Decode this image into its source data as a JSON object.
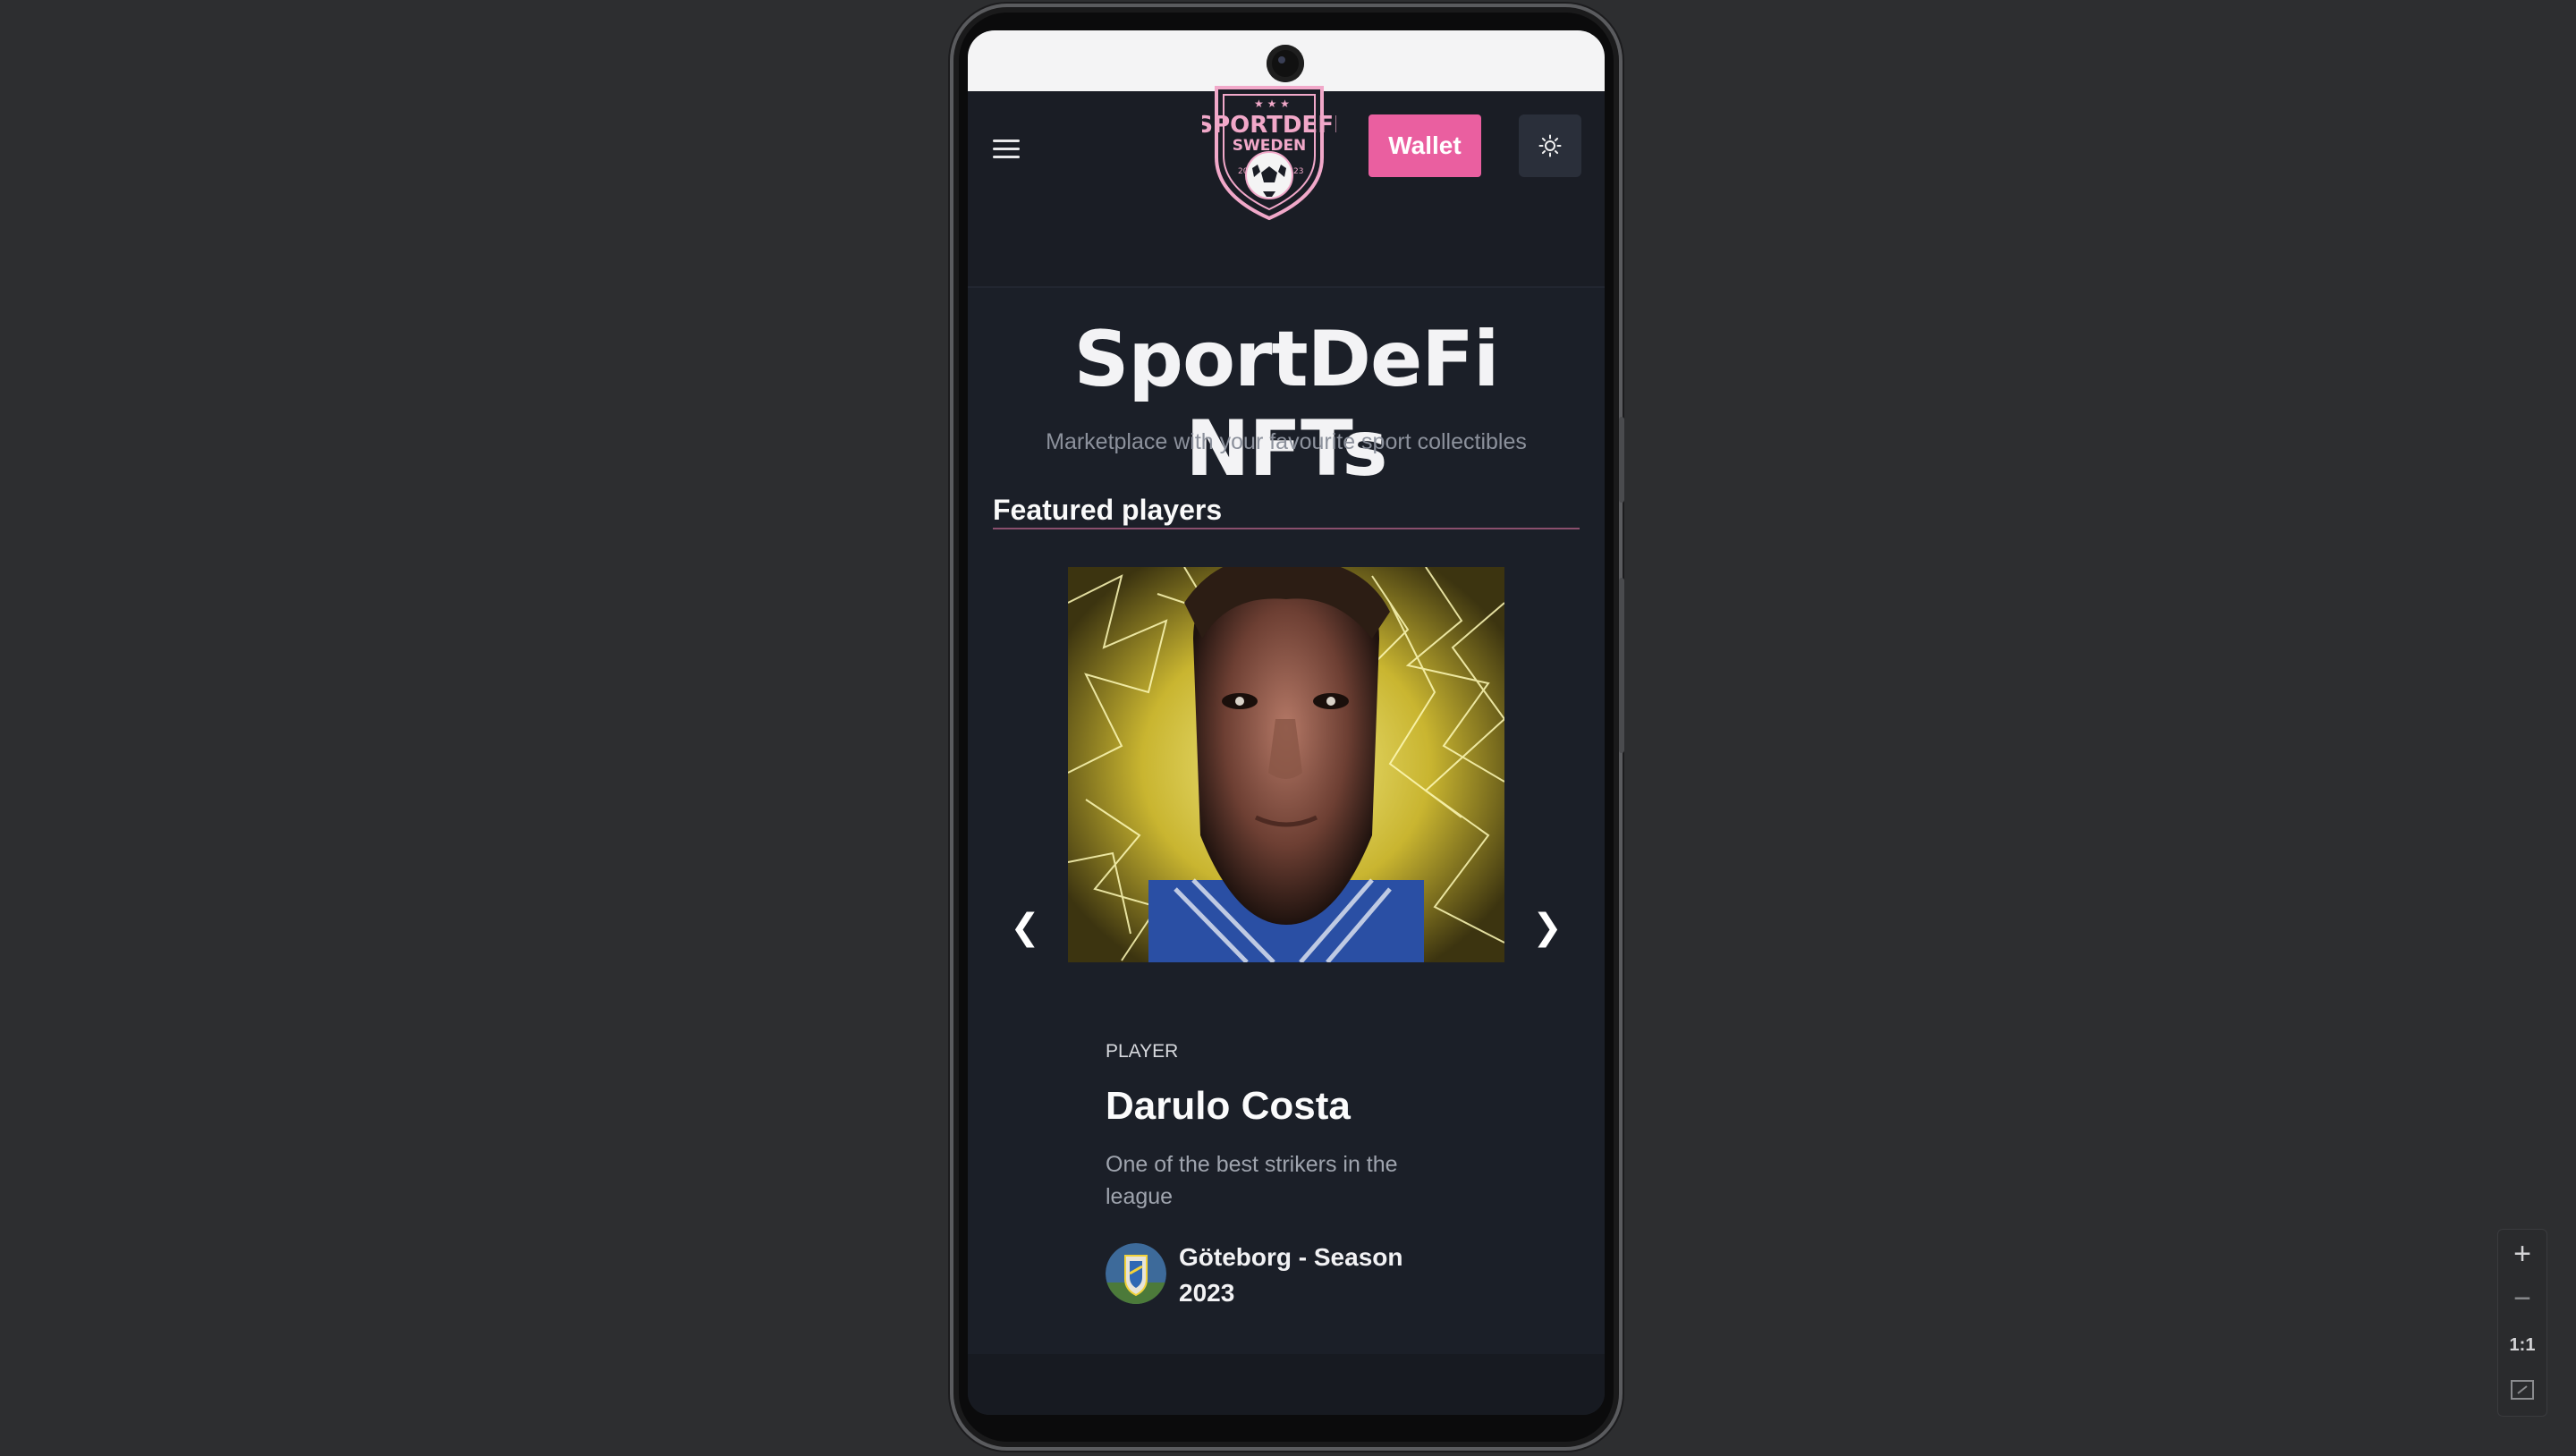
{
  "header": {
    "logo_text_top": "SPORTDEFI",
    "logo_text_bottom": "SWEDEN",
    "logo_year_left": "20",
    "logo_year_right": "23",
    "wallet_label": "Wallet",
    "menu_icon": "hamburger-icon",
    "theme_icon": "sun-icon"
  },
  "hero": {
    "title": "SportDeFi NFTs",
    "subtitle": "Marketplace with your favourite sport collectibles"
  },
  "featured": {
    "section_title": "Featured players",
    "prev_label": "❮",
    "next_label": "❯",
    "card": {
      "kicker": "PLAYER",
      "name": "Darulo Costa",
      "description": "One of the best strikers in the league",
      "team": "Göteborg - Season 2023"
    }
  },
  "zoom": {
    "zoom_in": "+",
    "zoom_out": "−",
    "actual_size": "1:1",
    "fit_icon": "fit-screen-icon"
  },
  "colors": {
    "accent": "#ea5fa0",
    "background": "#1b1f28",
    "page_bg": "#2d2e30"
  }
}
